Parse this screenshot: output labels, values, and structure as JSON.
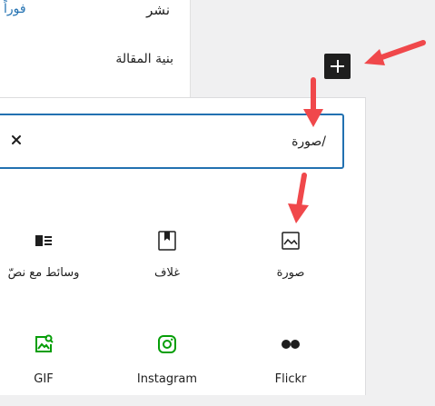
{
  "sidebar": {
    "publish_label": "نشر",
    "publish_value": "فوراً",
    "structure_label": "بنية المقالة"
  },
  "inserter": {
    "search_value": "/صورة"
  },
  "blocks": [
    {
      "label": "صورة",
      "icon": "image-icon"
    },
    {
      "label": "غلاف",
      "icon": "cover-icon"
    },
    {
      "label": "وسائط مع نصّ",
      "icon": "media-text-icon"
    },
    {
      "label": "Flickr",
      "icon": "flickr-icon"
    },
    {
      "label": "Instagram",
      "icon": "instagram-icon"
    },
    {
      "label": "GIF",
      "icon": "gif-icon"
    }
  ],
  "colors": {
    "accent": "#2271b1",
    "annotation_arrow": "#f0484b",
    "embed_green": "#069e08",
    "text": "#1e1e1e"
  }
}
